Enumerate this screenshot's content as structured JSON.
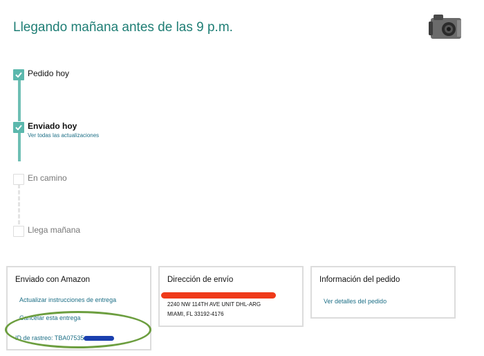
{
  "header": {
    "title": "Llegando mañana antes de las 9 p.m."
  },
  "timeline": {
    "steps": [
      {
        "label": "Pedido hoy",
        "state": "done"
      },
      {
        "label": "Enviado hoy",
        "state": "current",
        "link": "Ver todas las actualizaciones"
      },
      {
        "label": "En camino",
        "state": "pending"
      },
      {
        "label": "Llega mañana",
        "state": "pending"
      }
    ],
    "accent_color": "#5bb8ad"
  },
  "cards": {
    "shipping": {
      "title": "Enviado con Amazon",
      "update_link": "Actualizar instrucciones de entrega",
      "cancel_link": "Cancelar esta entrega",
      "tracking_label": "ID de rastreo: TBA07535"
    },
    "address": {
      "title": "Dirección de envío",
      "line1": "2240 NW 114TH AVE UNIT DHL-ARG",
      "line2": "MIAMI, FL 33192-4176"
    },
    "order": {
      "title": "Información del pedido",
      "details_link": "Ver detalles del pedido"
    }
  },
  "product_thumbnail_icon": "camera-cage-icon",
  "link_color": "#1d6f86",
  "title_color": "#1f7e75"
}
